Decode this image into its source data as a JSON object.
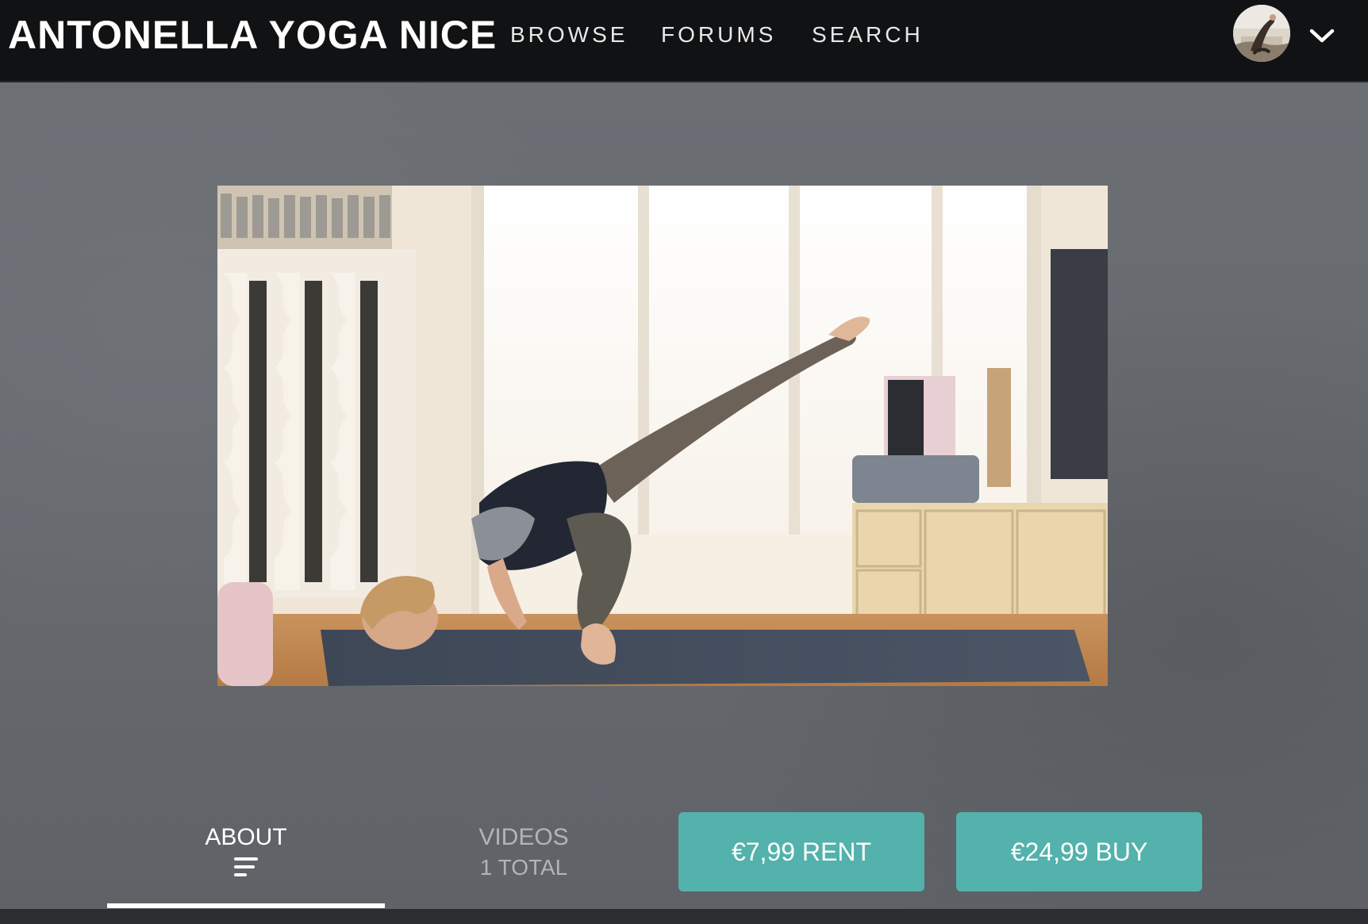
{
  "header": {
    "brand": "ANTONELLA YOGA NICE",
    "nav": {
      "browse": "BROWSE",
      "forums": "FORUMS",
      "search": "SEARCH"
    },
    "avatar_icon": "user-avatar",
    "menu_icon": "chevron-down-icon"
  },
  "hero": {
    "video_icon": "video-thumbnail"
  },
  "tabs": {
    "about": {
      "label": "ABOUT",
      "icon": "text-lines-icon",
      "active": true
    },
    "videos": {
      "label": "VIDEOS",
      "sub": "1 TOTAL",
      "active": false
    }
  },
  "actions": {
    "rent_label": "€7,99 RENT",
    "buy_label": "€24,99 BUY"
  },
  "colors": {
    "accent": "#53b2ab",
    "topbar": "#111213",
    "hero_bg": "#676b70"
  }
}
